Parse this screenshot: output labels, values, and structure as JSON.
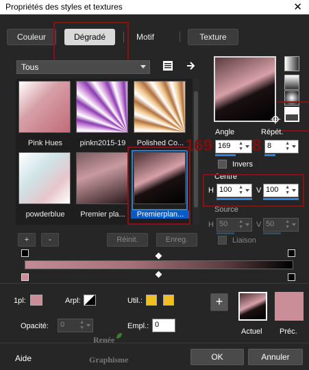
{
  "window": {
    "title": "Propriétés des styles et textures",
    "close": "✕"
  },
  "tabs": [
    {
      "label": "Couleur"
    },
    {
      "label": "Dégradé"
    },
    {
      "label": "Motif"
    },
    {
      "label": "Texture"
    }
  ],
  "filter": {
    "value": "Tous"
  },
  "gallery": [
    {
      "name": "Pink Hues"
    },
    {
      "name": "pinkn2015-19"
    },
    {
      "name": "Polished Co..."
    },
    {
      "name": "powderblue"
    },
    {
      "name": "Premier pla..."
    },
    {
      "name": "Premierplan..."
    }
  ],
  "buttons": {
    "add": "+",
    "remove": "-",
    "reset": "Réinit.",
    "save": "Enreg."
  },
  "angle": {
    "label": "Angle",
    "value": "169"
  },
  "repeat": {
    "label": "Répét.",
    "value": "8"
  },
  "annotations": {
    "angle": "169",
    "repeat": "8"
  },
  "invert": {
    "label": "Invers"
  },
  "centre": {
    "label": "Centre",
    "h_label": "H",
    "h_value": "100",
    "v_label": "V",
    "v_value": "100"
  },
  "source": {
    "label": "Source",
    "h_label": "H",
    "h_value": "50",
    "v_label": "V",
    "v_value": "50"
  },
  "link": {
    "label": "Liaison"
  },
  "bottom": {
    "first": "1pl:",
    "arpl": "Arpl:",
    "util": "Util.:",
    "opacity_label": "Opacité:",
    "opacity_value": "0",
    "empl_label": "Empl.:",
    "empl_value": "0",
    "actuel": "Actuel",
    "prec": "Préc.",
    "watermark_line1": "Renée",
    "watermark_line2": "Graphisme"
  },
  "footer": {
    "help": "Aide",
    "ok": "OK",
    "cancel": "Annuler"
  },
  "colors": {
    "accent": "#2e86e0",
    "annotation": "#8b1010",
    "prec_swatch": "#c98e98",
    "util_color": "#f0c020"
  }
}
